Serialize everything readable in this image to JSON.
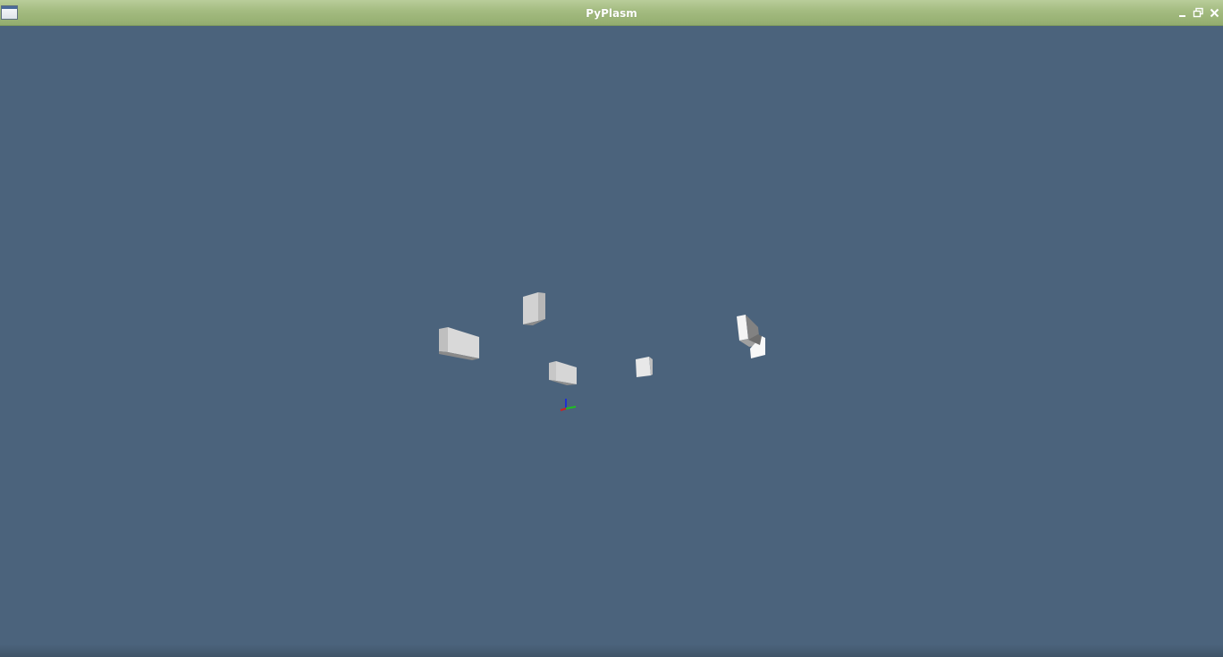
{
  "window": {
    "title": "PyPlasm",
    "app_icon": "window-icon",
    "controls": {
      "minimize_glyph": "–",
      "maximize_glyph": "🗗",
      "close_glyph": "✕"
    }
  },
  "viewport": {
    "background_color": "#4b637c",
    "axes_colors": {
      "x": "#d02020",
      "y": "#20c020",
      "z": "#2030d0"
    }
  }
}
